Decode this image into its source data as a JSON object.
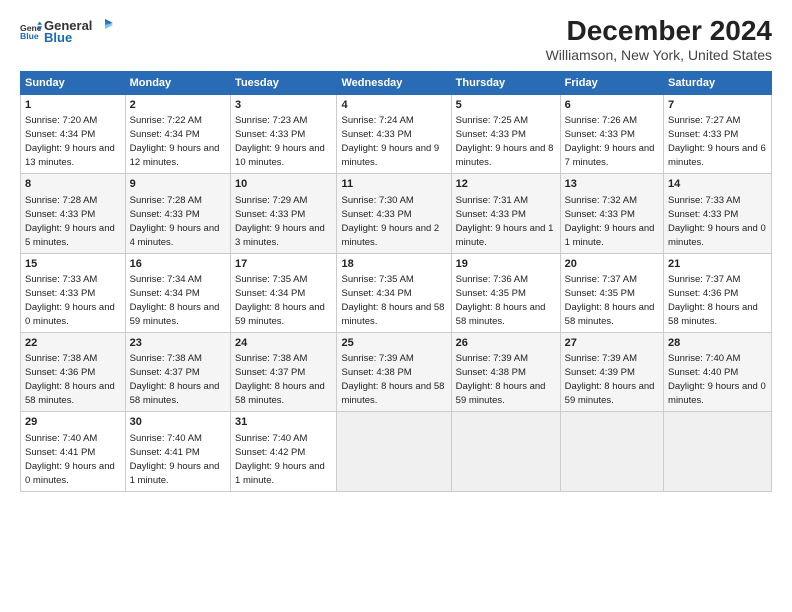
{
  "logo": {
    "general": "General",
    "blue": "Blue"
  },
  "title": "December 2024",
  "subtitle": "Williamson, New York, United States",
  "headers": [
    "Sunday",
    "Monday",
    "Tuesday",
    "Wednesday",
    "Thursday",
    "Friday",
    "Saturday"
  ],
  "weeks": [
    [
      {
        "day": "1",
        "rise": "7:20 AM",
        "set": "4:34 PM",
        "daylight": "9 hours and 13 minutes."
      },
      {
        "day": "2",
        "rise": "7:22 AM",
        "set": "4:34 PM",
        "daylight": "9 hours and 12 minutes."
      },
      {
        "day": "3",
        "rise": "7:23 AM",
        "set": "4:33 PM",
        "daylight": "9 hours and 10 minutes."
      },
      {
        "day": "4",
        "rise": "7:24 AM",
        "set": "4:33 PM",
        "daylight": "9 hours and 9 minutes."
      },
      {
        "day": "5",
        "rise": "7:25 AM",
        "set": "4:33 PM",
        "daylight": "9 hours and 8 minutes."
      },
      {
        "day": "6",
        "rise": "7:26 AM",
        "set": "4:33 PM",
        "daylight": "9 hours and 7 minutes."
      },
      {
        "day": "7",
        "rise": "7:27 AM",
        "set": "4:33 PM",
        "daylight": "9 hours and 6 minutes."
      }
    ],
    [
      {
        "day": "8",
        "rise": "7:28 AM",
        "set": "4:33 PM",
        "daylight": "9 hours and 5 minutes."
      },
      {
        "day": "9",
        "rise": "7:28 AM",
        "set": "4:33 PM",
        "daylight": "9 hours and 4 minutes."
      },
      {
        "day": "10",
        "rise": "7:29 AM",
        "set": "4:33 PM",
        "daylight": "9 hours and 3 minutes."
      },
      {
        "day": "11",
        "rise": "7:30 AM",
        "set": "4:33 PM",
        "daylight": "9 hours and 2 minutes."
      },
      {
        "day": "12",
        "rise": "7:31 AM",
        "set": "4:33 PM",
        "daylight": "9 hours and 1 minute."
      },
      {
        "day": "13",
        "rise": "7:32 AM",
        "set": "4:33 PM",
        "daylight": "9 hours and 1 minute."
      },
      {
        "day": "14",
        "rise": "7:33 AM",
        "set": "4:33 PM",
        "daylight": "9 hours and 0 minutes."
      }
    ],
    [
      {
        "day": "15",
        "rise": "7:33 AM",
        "set": "4:33 PM",
        "daylight": "9 hours and 0 minutes."
      },
      {
        "day": "16",
        "rise": "7:34 AM",
        "set": "4:34 PM",
        "daylight": "8 hours and 59 minutes."
      },
      {
        "day": "17",
        "rise": "7:35 AM",
        "set": "4:34 PM",
        "daylight": "8 hours and 59 minutes."
      },
      {
        "day": "18",
        "rise": "7:35 AM",
        "set": "4:34 PM",
        "daylight": "8 hours and 58 minutes."
      },
      {
        "day": "19",
        "rise": "7:36 AM",
        "set": "4:35 PM",
        "daylight": "8 hours and 58 minutes."
      },
      {
        "day": "20",
        "rise": "7:37 AM",
        "set": "4:35 PM",
        "daylight": "8 hours and 58 minutes."
      },
      {
        "day": "21",
        "rise": "7:37 AM",
        "set": "4:36 PM",
        "daylight": "8 hours and 58 minutes."
      }
    ],
    [
      {
        "day": "22",
        "rise": "7:38 AM",
        "set": "4:36 PM",
        "daylight": "8 hours and 58 minutes."
      },
      {
        "day": "23",
        "rise": "7:38 AM",
        "set": "4:37 PM",
        "daylight": "8 hours and 58 minutes."
      },
      {
        "day": "24",
        "rise": "7:38 AM",
        "set": "4:37 PM",
        "daylight": "8 hours and 58 minutes."
      },
      {
        "day": "25",
        "rise": "7:39 AM",
        "set": "4:38 PM",
        "daylight": "8 hours and 58 minutes."
      },
      {
        "day": "26",
        "rise": "7:39 AM",
        "set": "4:38 PM",
        "daylight": "8 hours and 59 minutes."
      },
      {
        "day": "27",
        "rise": "7:39 AM",
        "set": "4:39 PM",
        "daylight": "8 hours and 59 minutes."
      },
      {
        "day": "28",
        "rise": "7:40 AM",
        "set": "4:40 PM",
        "daylight": "9 hours and 0 minutes."
      }
    ],
    [
      {
        "day": "29",
        "rise": "7:40 AM",
        "set": "4:41 PM",
        "daylight": "9 hours and 0 minutes."
      },
      {
        "day": "30",
        "rise": "7:40 AM",
        "set": "4:41 PM",
        "daylight": "9 hours and 1 minute."
      },
      {
        "day": "31",
        "rise": "7:40 AM",
        "set": "4:42 PM",
        "daylight": "9 hours and 1 minute."
      },
      null,
      null,
      null,
      null
    ]
  ]
}
